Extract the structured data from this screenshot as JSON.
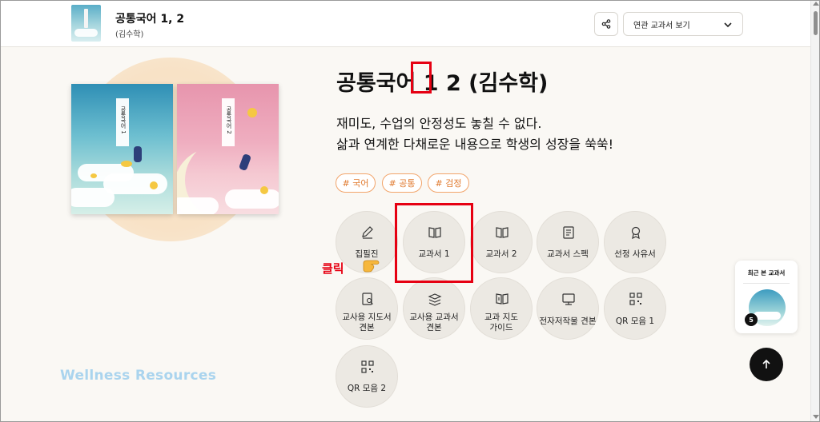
{
  "header": {
    "title": "공통국어 1, 2",
    "author": "(김수학)",
    "related_select": {
      "selected": "연관 교과서 보기"
    }
  },
  "hero": {
    "title": "공통국어 1 2 (김수학)",
    "title_parts": {
      "before": "공통국어 ",
      "highlight": "1",
      "after": " 2 (김수학)"
    },
    "desc_line1": "재미도, 수업의 안정성도 놓칠 수 없다.",
    "desc_line2": "삶과 연계한 다채로운 내용으로 학생의 성장을 쑥쑥!",
    "book1_spine": "공통국어 1",
    "book2_spine": "공통국어 2"
  },
  "tags": [
    "# 국어",
    "# 공통",
    "# 검정"
  ],
  "menu": [
    {
      "label": "집필진",
      "icon": "pen-icon"
    },
    {
      "label": "교과서 1",
      "icon": "book-open-icon"
    },
    {
      "label": "교과서 2",
      "icon": "book-open-icon"
    },
    {
      "label": "교과서 스펙",
      "icon": "document-icon"
    },
    {
      "label": "선정 사유서",
      "icon": "award-icon"
    },
    {
      "label": "교사용 지도서\n견본",
      "icon": "teacher-guide-icon"
    },
    {
      "label": "교사용 교과서\n견본",
      "icon": "stack-icon"
    },
    {
      "label": "교과 지도\n가이드",
      "icon": "book-info-icon"
    },
    {
      "label": "전자저작물 견본",
      "icon": "monitor-icon"
    },
    {
      "label": "QR 모음 1",
      "icon": "qr-icon"
    },
    {
      "label": "QR 모음 2",
      "icon": "qr-icon"
    }
  ],
  "annotation": {
    "click_label": "클릭"
  },
  "watermark": "Wellness Resources",
  "recent": {
    "title": "최근 본 교과서",
    "count": "5"
  },
  "colors": {
    "accent": "#e60012",
    "tag": "#e07a2f",
    "background": "#faf8f4"
  }
}
